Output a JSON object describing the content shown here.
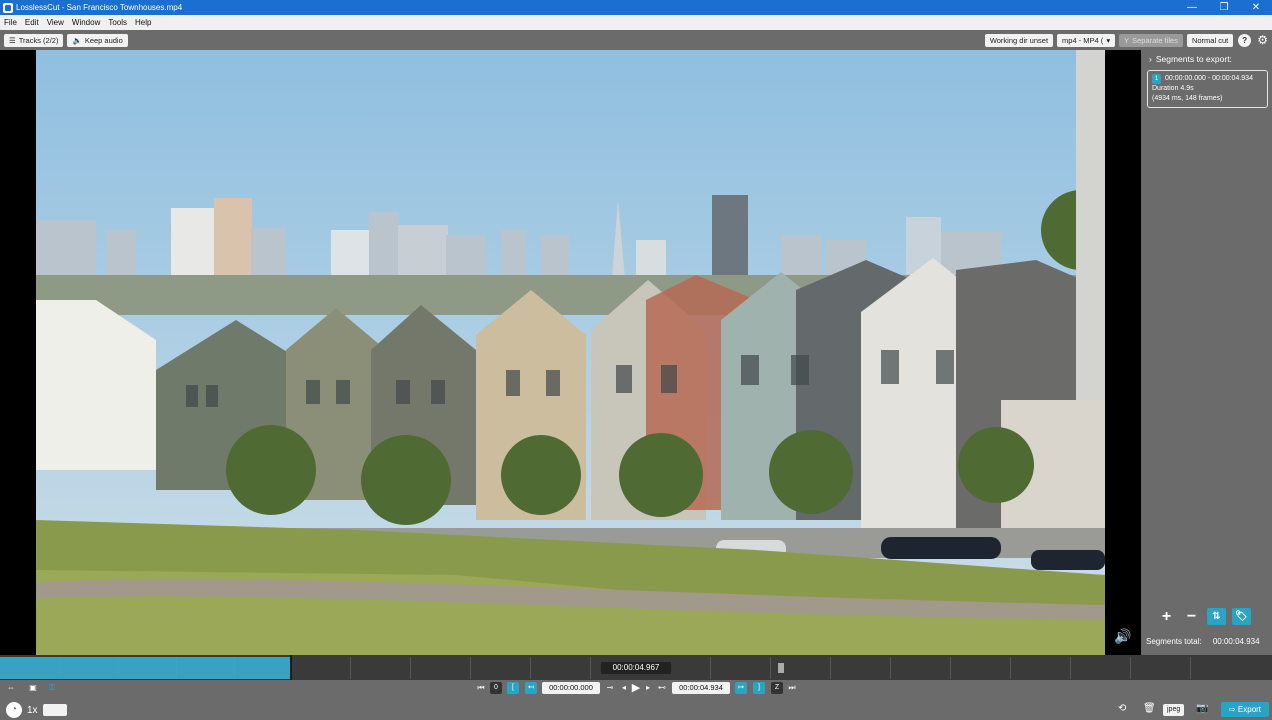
{
  "window": {
    "title": "LosslessCut - San Francisco Townhouses.mp4",
    "minimize": "—",
    "maximize": "❐",
    "close": "✕"
  },
  "menu": [
    "File",
    "Edit",
    "View",
    "Window",
    "Tools",
    "Help"
  ],
  "toolbar": {
    "tracks_label": "Tracks (2/2)",
    "keep_audio_label": "Keep audio",
    "working_dir_label": "Working dir unset",
    "format_label": "mp4 - MP4 (",
    "separate_files_label": "Separate files",
    "cut_mode_label": "Normal cut",
    "help_label": "?"
  },
  "sidebar": {
    "segments_title": "Segments to export:",
    "segment": {
      "index": "1",
      "range": "00:00:00.000 - 00:00:04.934",
      "duration": "Duration 4.9s",
      "detail": "(4934 ms, 148 frames)"
    },
    "segments_total_label": "Segments total:",
    "segments_total_value": "00:00:04.934"
  },
  "timeline": {
    "current_time": "00:00:04.967"
  },
  "controls": {
    "start_time": "00:00:00.000",
    "end_time": "00:00:04.934",
    "playback_rate": "1x",
    "capture_format": "jpeg",
    "export_label": "Export"
  },
  "colors": {
    "accent": "#2aa4c5",
    "titlebar": "#1b6fd1",
    "panel": "#6b6b6b"
  }
}
